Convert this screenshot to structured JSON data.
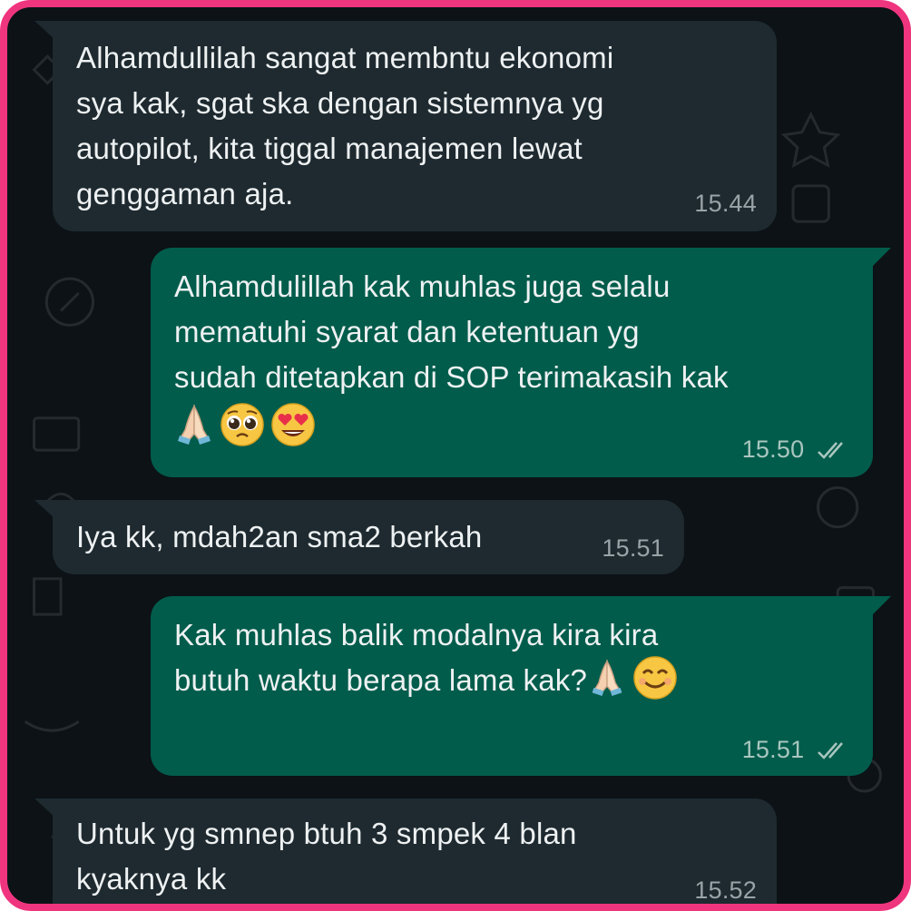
{
  "chat": {
    "messages": [
      {
        "direction": "incoming",
        "text": "Alhamdullilah sangat membntu ekonomi\nsya kak, sgat ska dengan sistemnya yg\nautopilot, kita tiggal manajemen lewat\ngenggaman aja.",
        "time": "15.44"
      },
      {
        "direction": "outgoing",
        "text": "Alhamdulillah kak muhlas juga selalu\nmematuhi syarat dan ketentuan yg\nsudah ditetapkan di SOP terimakasih kak",
        "emojis": [
          "folded-hands-icon",
          "pleading-face-icon",
          "heart-eyes-face-icon"
        ],
        "time": "15.50",
        "status": "read"
      },
      {
        "direction": "incoming",
        "text": "Iya kk, mdah2an sma2 berkah",
        "time": "15.51"
      },
      {
        "direction": "outgoing",
        "text": "Kak muhlas balik modalnya kira kira\nbutuh waktu berapa lama kak?",
        "emojis": [
          "folded-hands-icon",
          "smiling-face-icon"
        ],
        "time": "15.51",
        "status": "read"
      },
      {
        "direction": "incoming",
        "text": "Untuk yg smnep btuh 3 smpek 4 blan\nkyaknya kk",
        "time": "15.52"
      }
    ]
  },
  "colors": {
    "frame_border": "#f0357f",
    "background": "#0c1216",
    "incoming_bubble": "#1e2a30",
    "outgoing_bubble": "#015c4b",
    "read_ticks": "#a9c6bf"
  }
}
